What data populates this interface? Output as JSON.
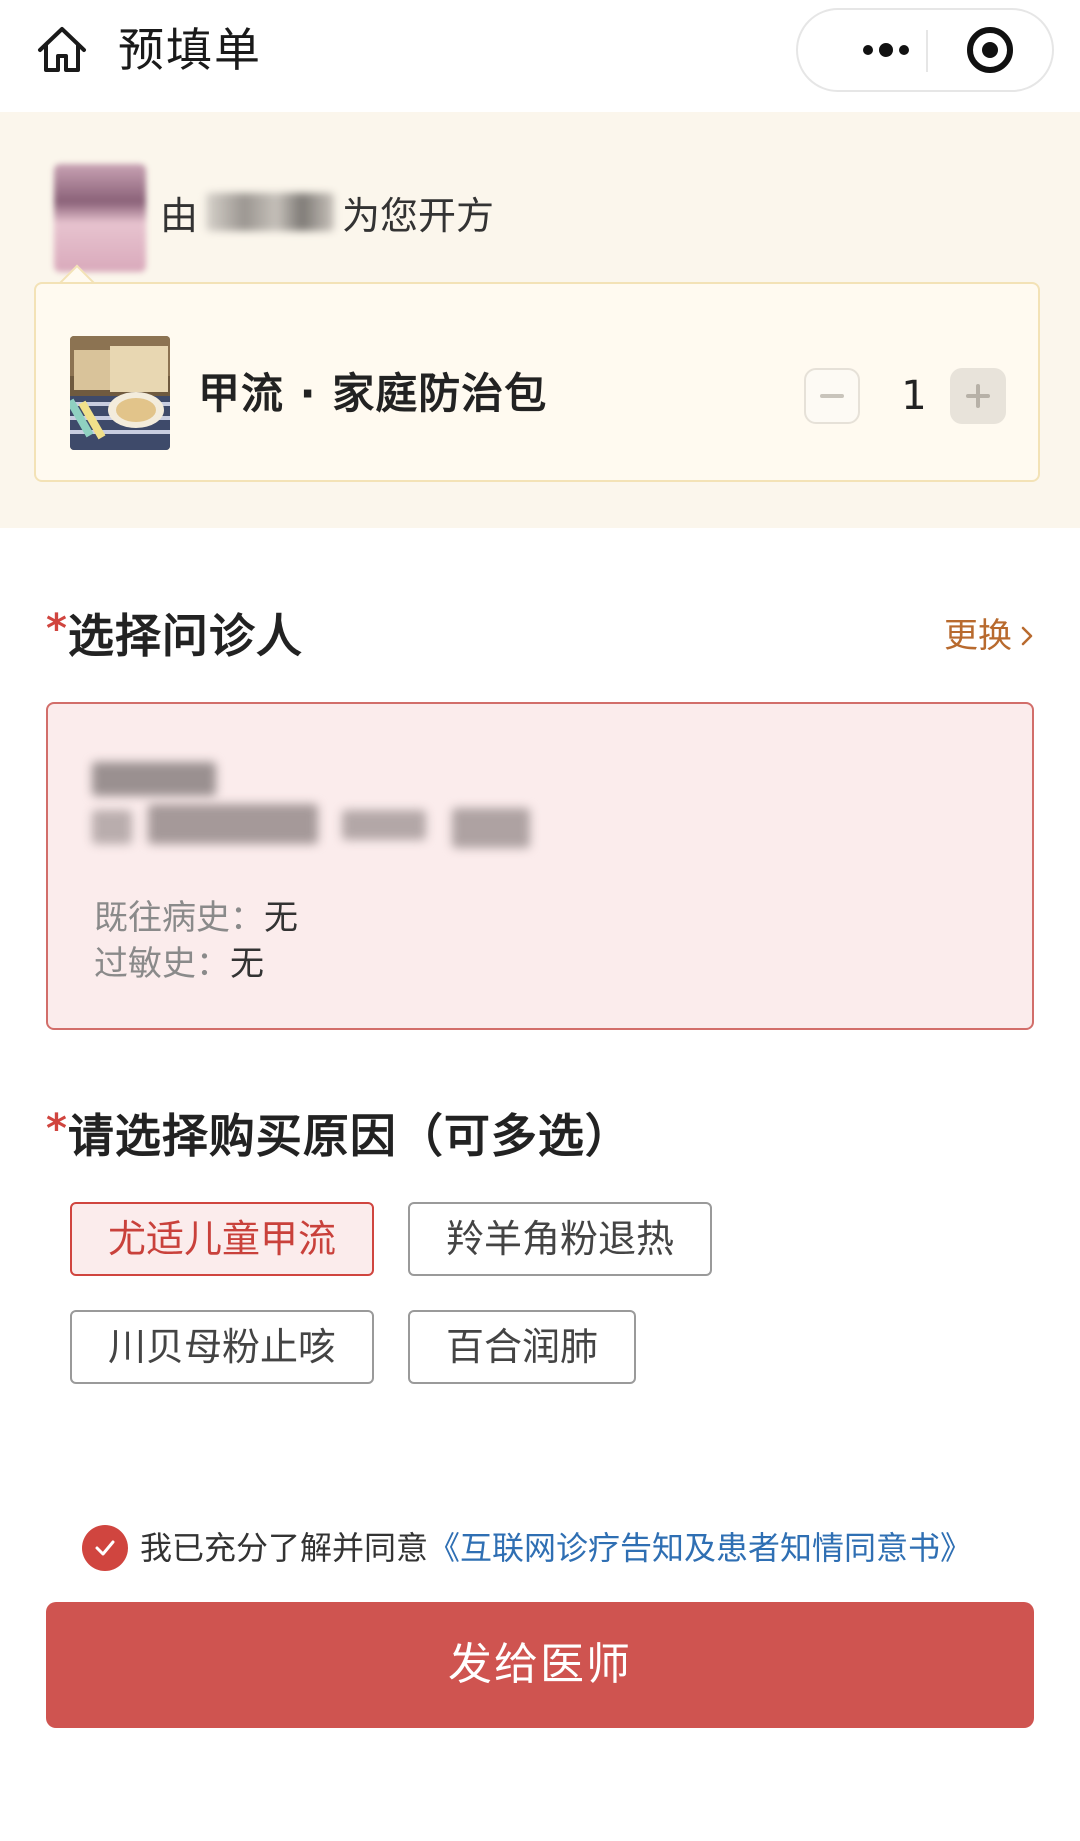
{
  "nav": {
    "title": "预填单",
    "icons": [
      "home-icon",
      "more-dots-icon",
      "close-target-icon"
    ]
  },
  "prescriber": {
    "prefix": "由",
    "suffix": "为您开方"
  },
  "product": {
    "name": "甲流 · 家庭防治包",
    "quantity": "1",
    "minus_icon": "minus-icon",
    "plus_icon": "plus-icon"
  },
  "patient_section": {
    "required_mark": "*",
    "title": "选择问诊人",
    "change_label": "更换",
    "history_label": "既往病史：",
    "history_value": "无",
    "allergy_label": "过敏史：",
    "allergy_value": "无"
  },
  "reason_section": {
    "required_mark": "*",
    "title": "请选择购买原因（可多选）",
    "options": [
      {
        "label": "尤适儿童甲流",
        "selected": true
      },
      {
        "label": "羚羊角粉退热",
        "selected": false
      },
      {
        "label": "川贝母粉止咳",
        "selected": false
      },
      {
        "label": "百合润肺",
        "selected": false
      }
    ]
  },
  "agreement": {
    "text": "我已充分了解并同意",
    "link": "《互联网诊疗告知及患者知情同意书》",
    "checked": true
  },
  "submit": {
    "label": "发给医师"
  },
  "colors": {
    "accent_red": "#cf5450",
    "banner_bg": "#fbf6ec",
    "link_blue": "#2f6fb3",
    "change_orange": "#b86a2e"
  }
}
